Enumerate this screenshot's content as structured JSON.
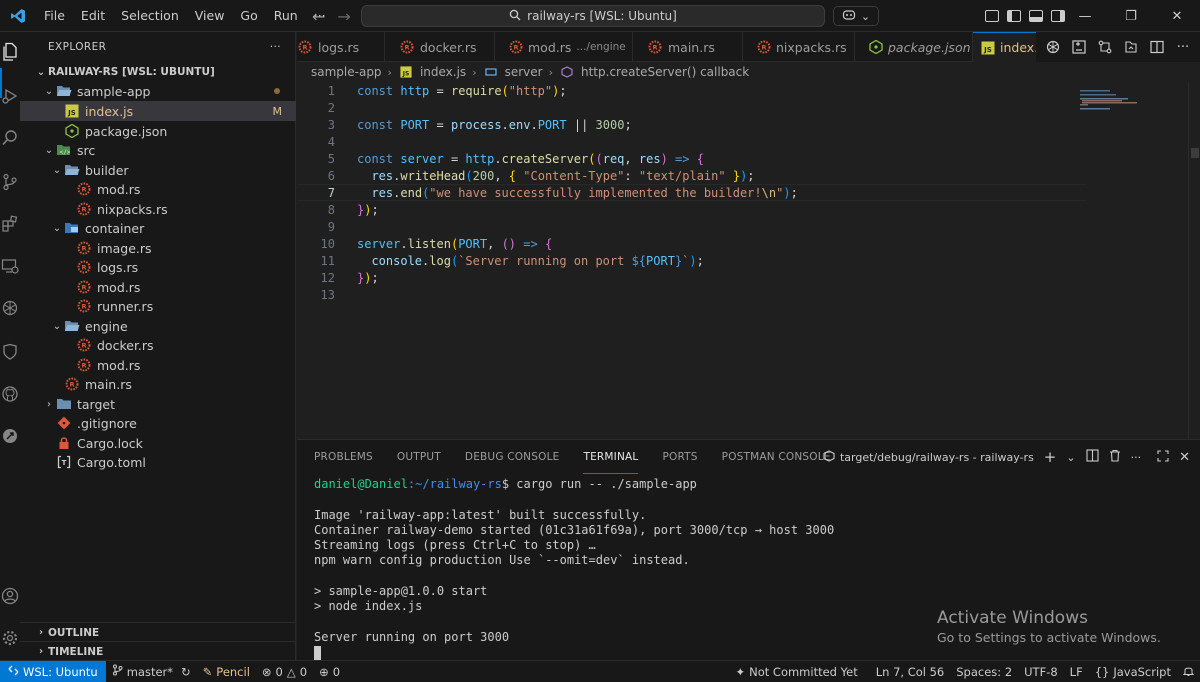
{
  "window": {
    "menu": [
      "File",
      "Edit",
      "Selection",
      "View",
      "Go",
      "Run",
      "···"
    ],
    "command_center": "railway-rs [WSL: Ubuntu]",
    "controls": {
      "minimize": "—",
      "restore": "❐",
      "close": "✕"
    }
  },
  "sidebar": {
    "header": "EXPLORER",
    "more": "···",
    "tree": [
      {
        "label": "RAILWAY-RS [WSL: UBUNTU]",
        "kind": "root"
      },
      {
        "label": "sample-app",
        "kind": "folder"
      },
      {
        "label": "index.js",
        "kind": "js",
        "badge": "M"
      },
      {
        "label": "package.json",
        "kind": "json"
      },
      {
        "label": "src",
        "kind": "folder"
      },
      {
        "label": "builder",
        "kind": "folder"
      },
      {
        "label": "mod.rs",
        "kind": "rs"
      },
      {
        "label": "nixpacks.rs",
        "kind": "rs"
      },
      {
        "label": "container",
        "kind": "folder"
      },
      {
        "label": "image.rs",
        "kind": "rs"
      },
      {
        "label": "logs.rs",
        "kind": "rs"
      },
      {
        "label": "mod.rs",
        "kind": "rs"
      },
      {
        "label": "runner.rs",
        "kind": "rs"
      },
      {
        "label": "engine",
        "kind": "folder"
      },
      {
        "label": "docker.rs",
        "kind": "rs"
      },
      {
        "label": "mod.rs",
        "kind": "rs"
      },
      {
        "label": "main.rs",
        "kind": "rs"
      },
      {
        "label": "target",
        "kind": "folder"
      },
      {
        "label": ".gitignore",
        "kind": "git"
      },
      {
        "label": "Cargo.lock",
        "kind": "lock"
      },
      {
        "label": "Cargo.toml",
        "kind": "toml"
      }
    ],
    "outline": "OUTLINE",
    "timeline": "TIMELINE"
  },
  "tabs": [
    {
      "label": "logs.rs",
      "kind": "rs"
    },
    {
      "label": "docker.rs",
      "kind": "rs"
    },
    {
      "label": "mod.rs",
      "desc": ".../engine",
      "kind": "rs"
    },
    {
      "label": "main.rs",
      "kind": "rs"
    },
    {
      "label": "nixpacks.rs",
      "kind": "rs"
    },
    {
      "label": "package.json",
      "kind": "json"
    },
    {
      "label": "index.js",
      "mod": "M",
      "close": "✕",
      "kind": "js"
    }
  ],
  "breadcrumb": [
    "sample-app",
    "index.js",
    "server",
    "http.createServer() callback"
  ],
  "editor": {
    "line_numbers": [
      "1",
      "2",
      "3",
      "4",
      "5",
      "6",
      "7",
      "8",
      "9",
      "10",
      "11",
      "12",
      "13"
    ],
    "current_line": 7
  },
  "panel": {
    "tabs": [
      "PROBLEMS",
      "OUTPUT",
      "DEBUG CONSOLE",
      "TERMINAL",
      "PORTS",
      "POSTMAN CONSOLE"
    ],
    "active_tab": "TERMINAL",
    "terminal_name": "target/debug/railway-rs - railway-rs",
    "terminal": {
      "prompt_user": "daniel@Daniel",
      "prompt_path": ":~/railway-rs",
      "command": "$ cargo run -- ./sample-app",
      "lines": [
        "",
        "Image 'railway-app:latest' built successfully.",
        "Container railway-demo started (01c31a61f69a), port 3000/tcp → host 3000",
        "Streaming logs (press Ctrl+C to stop) …",
        "npm warn config production Use `--omit=dev` instead.",
        "",
        "> sample-app@1.0.0 start",
        "> node index.js",
        "",
        "Server running on port 3000"
      ]
    },
    "activate": {
      "title": "Activate Windows",
      "subtitle": "Go to Settings to activate Windows."
    }
  },
  "statusbar": {
    "remote": "WSL: Ubuntu",
    "branch": "master*",
    "pencil": "Pencil",
    "errors": "0",
    "warnings": "0",
    "ports": "0",
    "blame": "Not Committed Yet",
    "position": "Ln 7, Col 56",
    "spaces": "Spaces: 2",
    "encoding": "UTF-8",
    "eol": "LF",
    "language": "JavaScript"
  },
  "colors": {
    "accent": "#0078d4",
    "rust": "#e0563a",
    "js": "#cbcb41",
    "json": "#8dc149",
    "folder": "#6b8fb0"
  }
}
